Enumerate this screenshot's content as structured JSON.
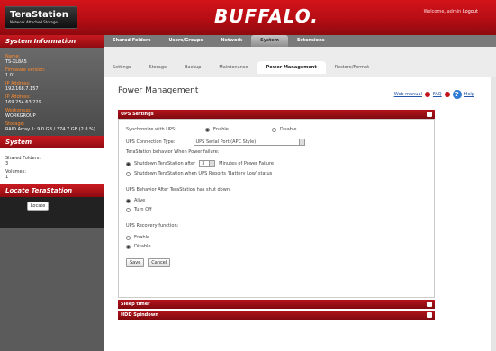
{
  "header": {
    "logo_title": "TeraStation",
    "logo_subtitle": "Network Attached Storage",
    "brand": "BUFFALO.",
    "welcome": "Welcome, admin",
    "logout": "Logout"
  },
  "sidebar": {
    "system_info_title": "System Information",
    "info": [
      {
        "label": "Name:",
        "value": "TS-XL8A5"
      },
      {
        "label": "Firmware version:",
        "value": "1.01"
      },
      {
        "label": "IP Address:",
        "value": "192.168.7.157"
      },
      {
        "label": "IP Address:",
        "value": "169.254.63.229"
      },
      {
        "label": "Workgroup:",
        "value": "WORKGROUP"
      },
      {
        "label": "Storage:",
        "value": "RAID Array 1: 9.0 GB / 374.7 GB (2.8 %)"
      }
    ],
    "system_title": "System",
    "system": [
      {
        "label": "Shared Folders:",
        "value": "3"
      },
      {
        "label": "Volumes:",
        "value": "1"
      }
    ],
    "locate_title": "Locate TeraStation",
    "locate_button": "Locate"
  },
  "main_tabs": [
    "Shared Folders",
    "Users/Groups",
    "Network",
    "System",
    "Extensions"
  ],
  "main_tab_active": "System",
  "sub_tabs": [
    "Settings",
    "Storage",
    "Backup",
    "Maintenance",
    "Power Management",
    "Restore/Format"
  ],
  "sub_tab_active": "Power Management",
  "page": {
    "title": "Power Management",
    "help_manual": "Web manual",
    "help_faq": "FAQ",
    "help_help": "Help"
  },
  "ups": {
    "section_title": "UPS Settings",
    "sync_label": "Synchronize with UPS:",
    "enable": "Enable",
    "disable": "Disable",
    "connection_label": "UPS Connection Type:",
    "connection_value": "UPS Serial Port (APC Style)",
    "behavior_label": "TeraStation behavior When Power failure:",
    "shutdown_after": "Shutdown TeraStation after",
    "minutes_value": "3",
    "minutes_suffix": "Minutes of Power Failure",
    "shutdown_low": "Shutdown TeraStation when UPS Reports 'Battery Low' status",
    "after_shutdown_label": "UPS Behavior After TeraStation has shut down:",
    "alive": "Alive",
    "turn_off": "Turn Off",
    "recovery_label": "UPS Recovery function:",
    "recovery_enable": "Enable",
    "recovery_disable": "Disable",
    "save": "Save",
    "cancel": "Cancel"
  },
  "sections": [
    "Sleep timer",
    "HDD Spindown"
  ]
}
